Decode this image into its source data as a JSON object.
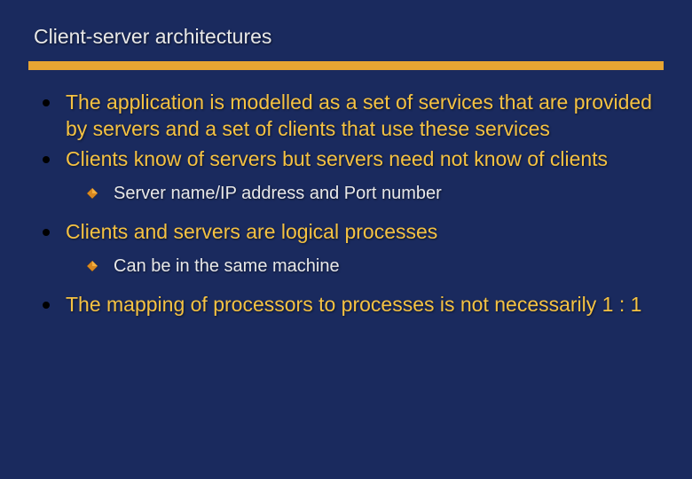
{
  "slide": {
    "title": "Client-server architectures",
    "bullets": [
      {
        "text": "The application is modelled as a set of services that are provided by servers and a set of clients that use these services",
        "sub": []
      },
      {
        "text": "Clients know of servers but servers need not know of clients",
        "sub": [
          "Server name/IP address and Port number"
        ]
      },
      {
        "text": "Clients and servers are logical processes",
        "sub": [
          "Can be in the same machine"
        ]
      },
      {
        "text": "The mapping of processors to processes is not necessarily 1 : 1",
        "sub": []
      }
    ]
  },
  "colors": {
    "background": "#1a2a5e",
    "divider": "#e8a532",
    "bullet_text": "#f5c242",
    "sub_text": "#e8e8e8"
  }
}
